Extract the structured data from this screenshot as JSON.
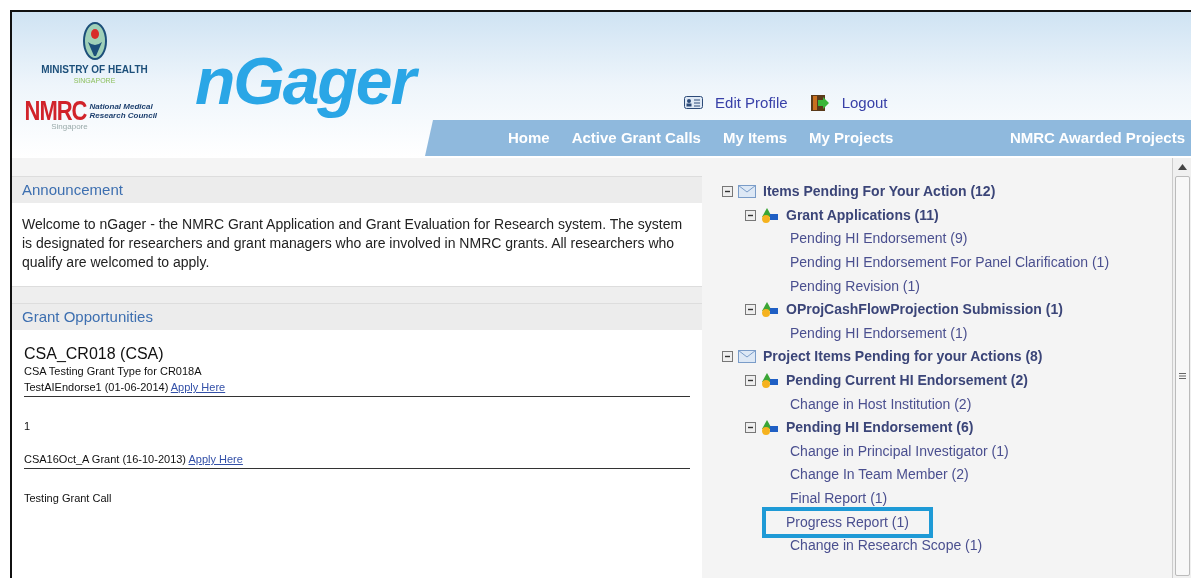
{
  "header": {
    "ministry": "MINISTRY OF HEALTH",
    "ministry_sub": "SINGAPORE",
    "council_short": "NMRC",
    "council_name": "National Medical Research Council",
    "council_sub": "Singapore",
    "app_name": "nGager",
    "user_links": [
      {
        "kind": "profile",
        "label": "Edit Profile"
      },
      {
        "kind": "logout",
        "label": "Logout"
      }
    ],
    "nav": [
      {
        "label": "Home"
      },
      {
        "label": "Active Grant Calls"
      },
      {
        "label": "My Items"
      },
      {
        "label": "My Projects"
      },
      {
        "label": "NMRC Awarded Projects"
      }
    ]
  },
  "announcement": {
    "title": "Announcement",
    "body": "Welcome to nGager - the NMRC Grant Application and Grant Evaluation for Research system. The system is designated for researchers and grant managers who are involved in NMRC grants. All researchers who qualify are welcomed to apply."
  },
  "grant_opportunities": {
    "title": "Grant Opportunities",
    "entries": [
      {
        "title": "CSA_CR018 (CSA)",
        "subtitle": "CSA Testing Grant Type for CR018A",
        "call": "TestAIEndorse1 (01-06-2014)",
        "link": "Apply Here",
        "description": "1"
      },
      {
        "call": "CSA16Oct_A Grant (16-10-2013)",
        "link": "Apply Here",
        "description": "Testing Grant Call"
      }
    ]
  },
  "tree": [
    {
      "label": "Items Pending For Your Action (12)",
      "expanded": true,
      "children": [
        {
          "label": "Grant Applications  (11)",
          "expanded": true,
          "children": [
            {
              "label": "Pending HI Endorsement (9)",
              "highlighted": false
            },
            {
              "label": "Pending HI Endorsement For Panel Clarification (1)",
              "highlighted": false
            },
            {
              "label": "Pending Revision (1)",
              "highlighted": false
            }
          ]
        },
        {
          "label": "OProjCashFlowProjection Submission  (1)",
          "expanded": true,
          "children": [
            {
              "label": "Pending HI Endorsement (1)",
              "highlighted": false
            }
          ]
        }
      ]
    },
    {
      "label": "Project Items Pending for your Actions (8)",
      "expanded": true,
      "children": [
        {
          "label": "Pending Current HI Endorsement (2)",
          "expanded": true,
          "children": [
            {
              "label": "Change in Host Institution (2)",
              "highlighted": false
            }
          ]
        },
        {
          "label": "Pending HI Endorsement (6)",
          "expanded": true,
          "children": [
            {
              "label": "Change in Principal Investigator (1)",
              "highlighted": false
            },
            {
              "label": "Change In Team Member (2)",
              "highlighted": false
            },
            {
              "label": "Final Report (1)",
              "highlighted": false
            },
            {
              "label": "Progress Report (1)",
              "highlighted": true
            },
            {
              "label": "Change in Research Scope (1)",
              "highlighted": false
            }
          ]
        }
      ]
    }
  ]
}
